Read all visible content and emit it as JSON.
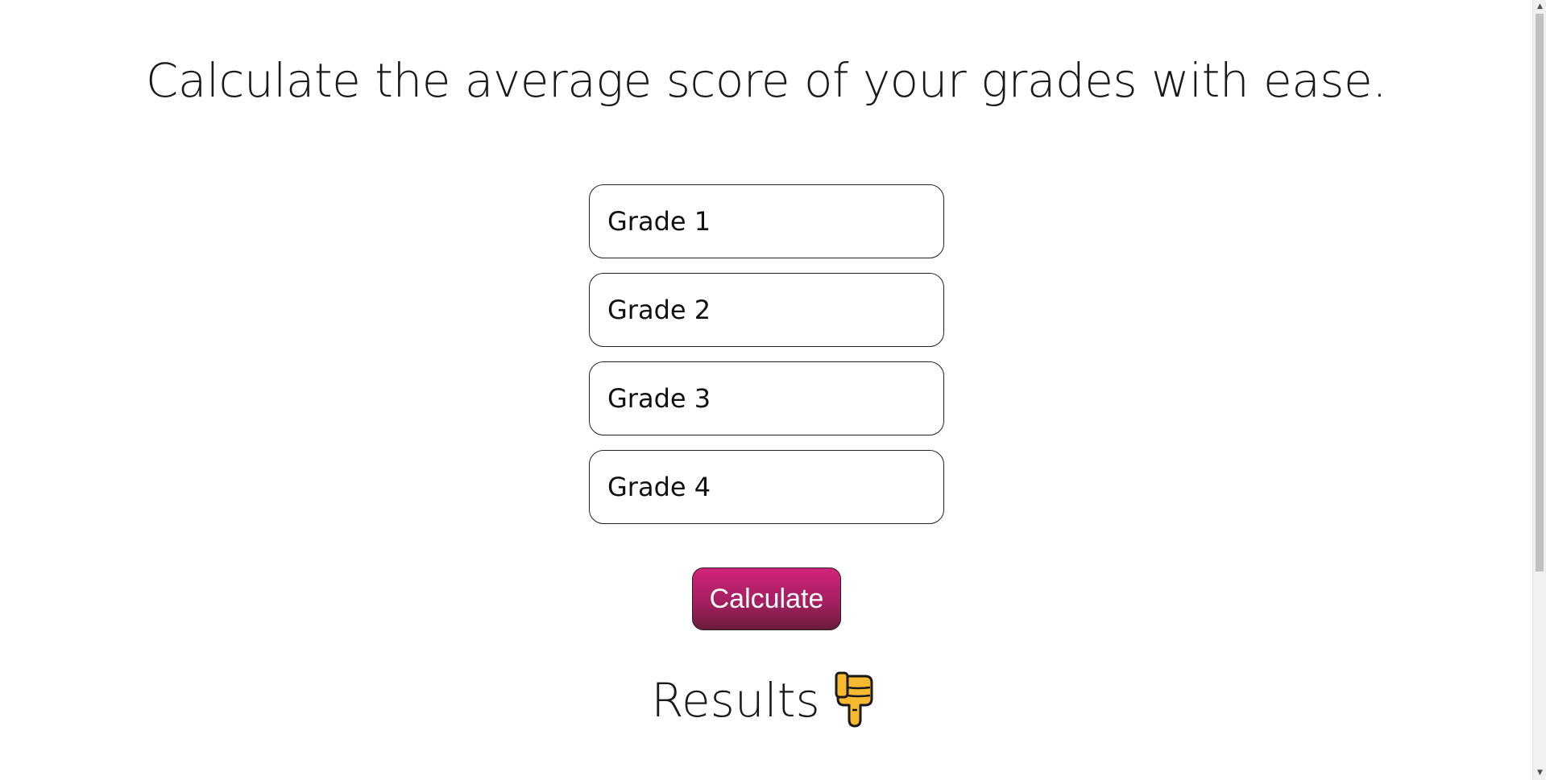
{
  "heading": "Calculate the average score of your grades with ease.",
  "grades": [
    {
      "placeholder": "Grade 1",
      "value": ""
    },
    {
      "placeholder": "Grade 2",
      "value": ""
    },
    {
      "placeholder": "Grade 3",
      "value": ""
    },
    {
      "placeholder": "Grade 4",
      "value": ""
    }
  ],
  "calculate_label": "Calculate",
  "results_label": "Results",
  "results_icon": "pointing-down-hand-icon",
  "colors": {
    "button_top": "#d2237a",
    "button_bottom": "#6a1c3d",
    "emoji_fill": "#f7b92f"
  },
  "scrollbar": {
    "up_glyph": "▲",
    "down_glyph": "▼"
  }
}
